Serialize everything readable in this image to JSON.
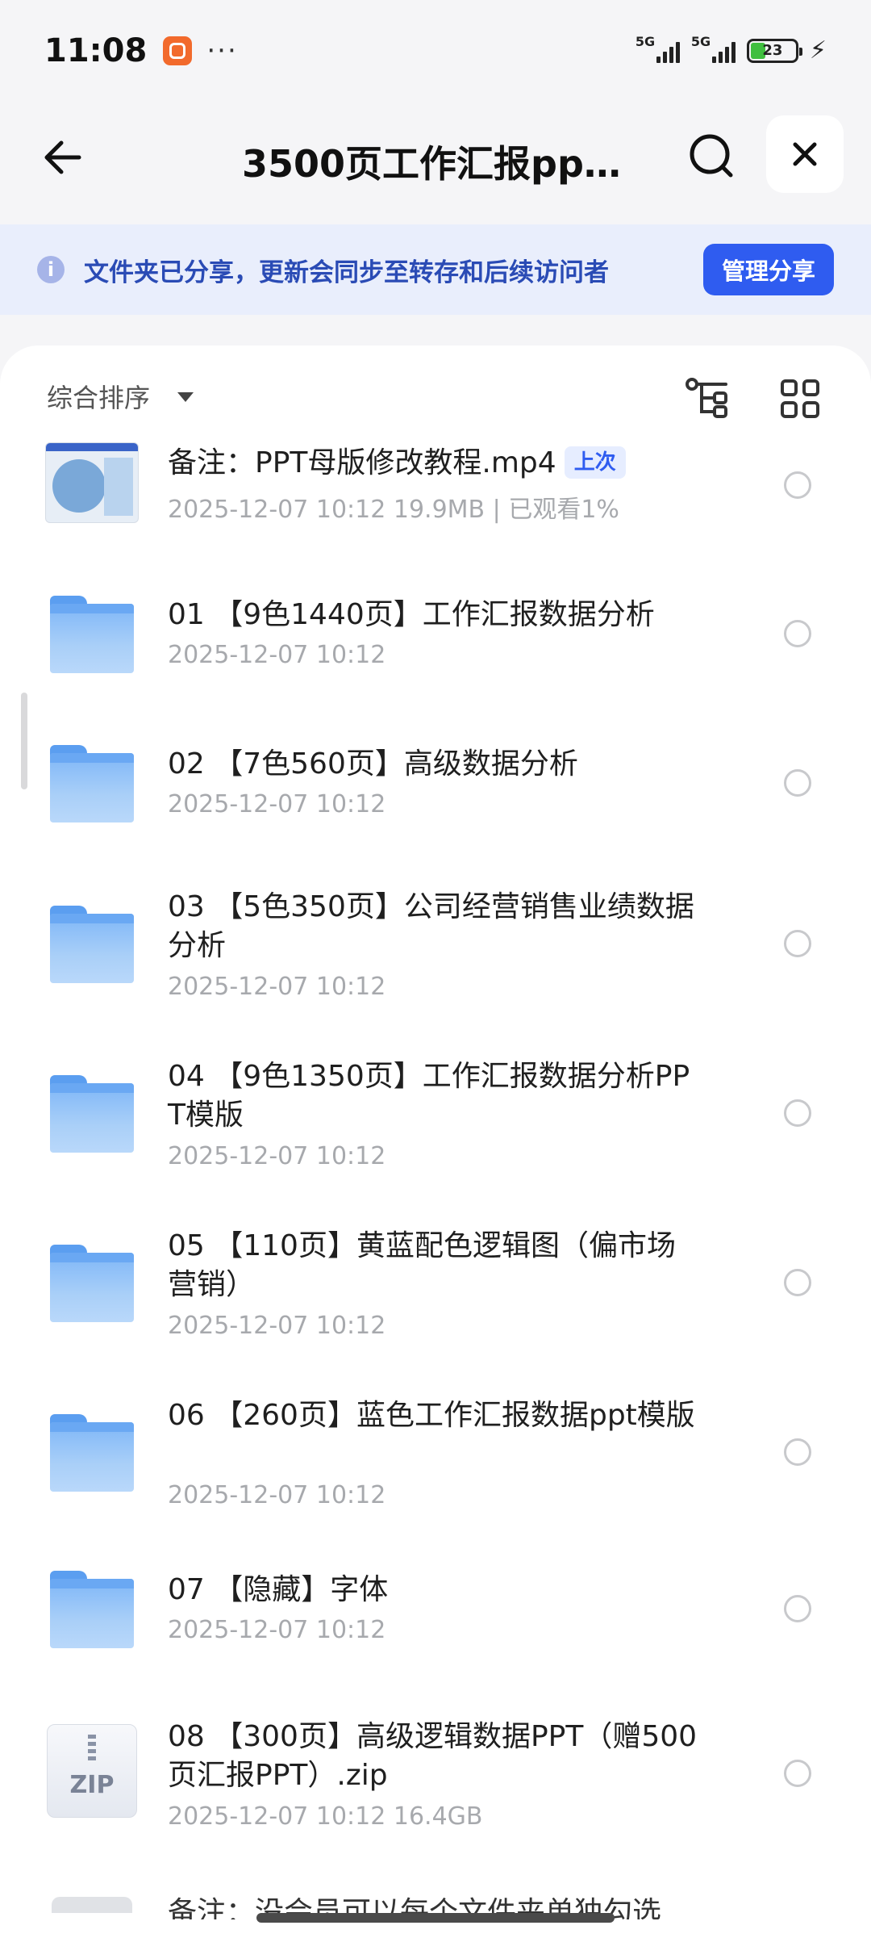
{
  "status": {
    "time": "11:08",
    "signal1": "5G",
    "signal2": "5G",
    "battery": "23",
    "more": "···"
  },
  "nav": {
    "title": "3500页工作汇报ppt…"
  },
  "banner": {
    "text": "文件夹已分享，更新会同步至转存和后续访问者",
    "button": "管理分享",
    "info": "i"
  },
  "sort": {
    "label": "综合排序"
  },
  "items": [
    {
      "type": "video",
      "name": "备注：PPT母版修改教程.mp4",
      "badge": "上次",
      "meta": "2025-12-07 10:12  19.9MB | 已观看1%"
    },
    {
      "type": "folder",
      "name": "01 【9色1440页】工作汇报数据分析",
      "meta": "2025-12-07 10:12"
    },
    {
      "type": "folder",
      "name": "02 【7色560页】高级数据分析",
      "meta": "2025-12-07 10:12"
    },
    {
      "type": "folder",
      "name": "03 【5色350页】公司经营销售业绩数据分析",
      "meta": "2025-12-07 10:12"
    },
    {
      "type": "folder",
      "name": "04 【9色1350页】工作汇报数据分析PPT模版",
      "meta": "2025-12-07 10:12"
    },
    {
      "type": "folder",
      "name": "05 【110页】黄蓝配色逻辑图（偏市场营销）",
      "meta": "2025-12-07 10:12"
    },
    {
      "type": "folder",
      "name": "06 【260页】蓝色工作汇报数据ppt模版",
      "meta": "2025-12-07 10:12"
    },
    {
      "type": "folder",
      "name": "07 【隐藏】字体",
      "meta": "2025-12-07 10:12"
    },
    {
      "type": "zip",
      "name": "08 【300页】高级逻辑数据PPT（赠500页汇报PPT）.zip",
      "meta": "2025-12-07 10:12  16.4GB",
      "zip_label": "ZIP"
    }
  ],
  "partial": "备注：没会员可以每个文件夹单独勾选"
}
